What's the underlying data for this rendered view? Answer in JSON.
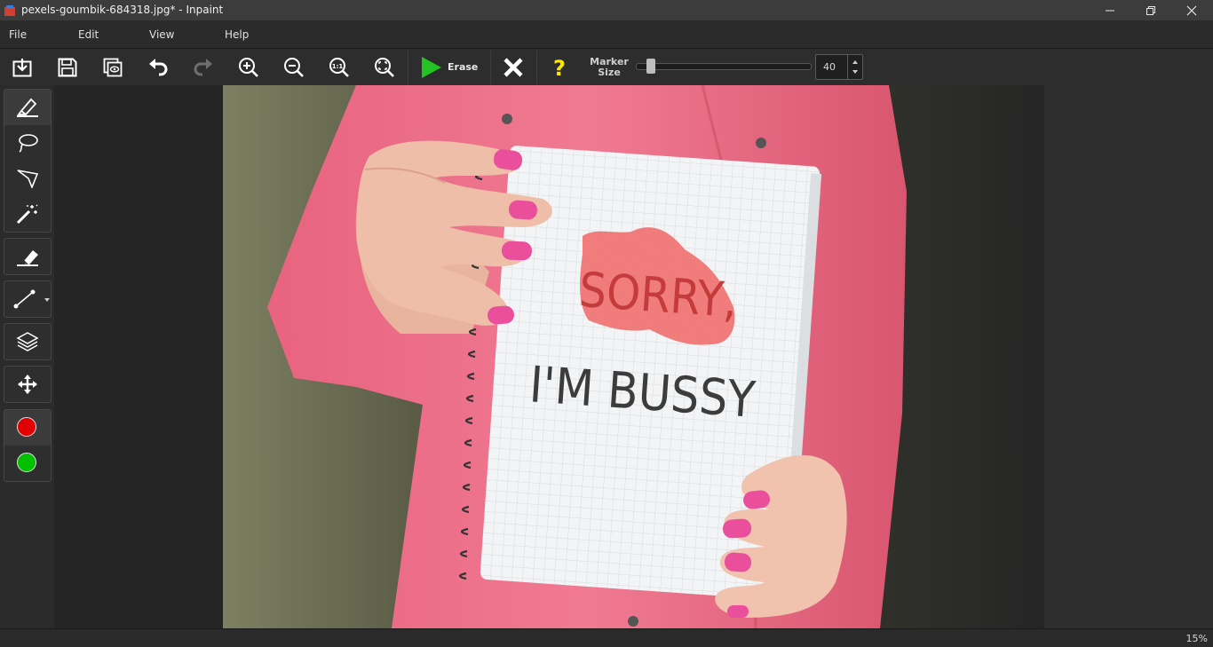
{
  "window": {
    "title": "pexels-goumbik-684318.jpg* - Inpaint"
  },
  "menu": [
    "File",
    "Edit",
    "View",
    "Help"
  ],
  "toolbar": {
    "erase_label": "Erase",
    "marker_label": "Marker Size",
    "marker_value": "40",
    "marker_fraction": 0.1,
    "icons": [
      "open-icon",
      "save-icon",
      "save-as-icon",
      "undo-icon",
      "redo-icon",
      "zoom-in-icon",
      "zoom-out-icon",
      "actual-size-icon",
      "fit-window-icon",
      "play-icon",
      "close-icon",
      "help-icon"
    ]
  },
  "sidebar": {
    "tools": [
      "marker-icon",
      "lasso-icon",
      "polygonal-lasso-icon",
      "magic-wand-icon",
      "eraser-icon",
      "line-icon",
      "layers-icon",
      "move-icon"
    ],
    "colors": {
      "mask": "#e00000",
      "keep": "#00c000"
    }
  },
  "notebook": {
    "line1": "SORRY,",
    "line2": "I'M BUSSY"
  },
  "status": {
    "zoom": "15%"
  }
}
